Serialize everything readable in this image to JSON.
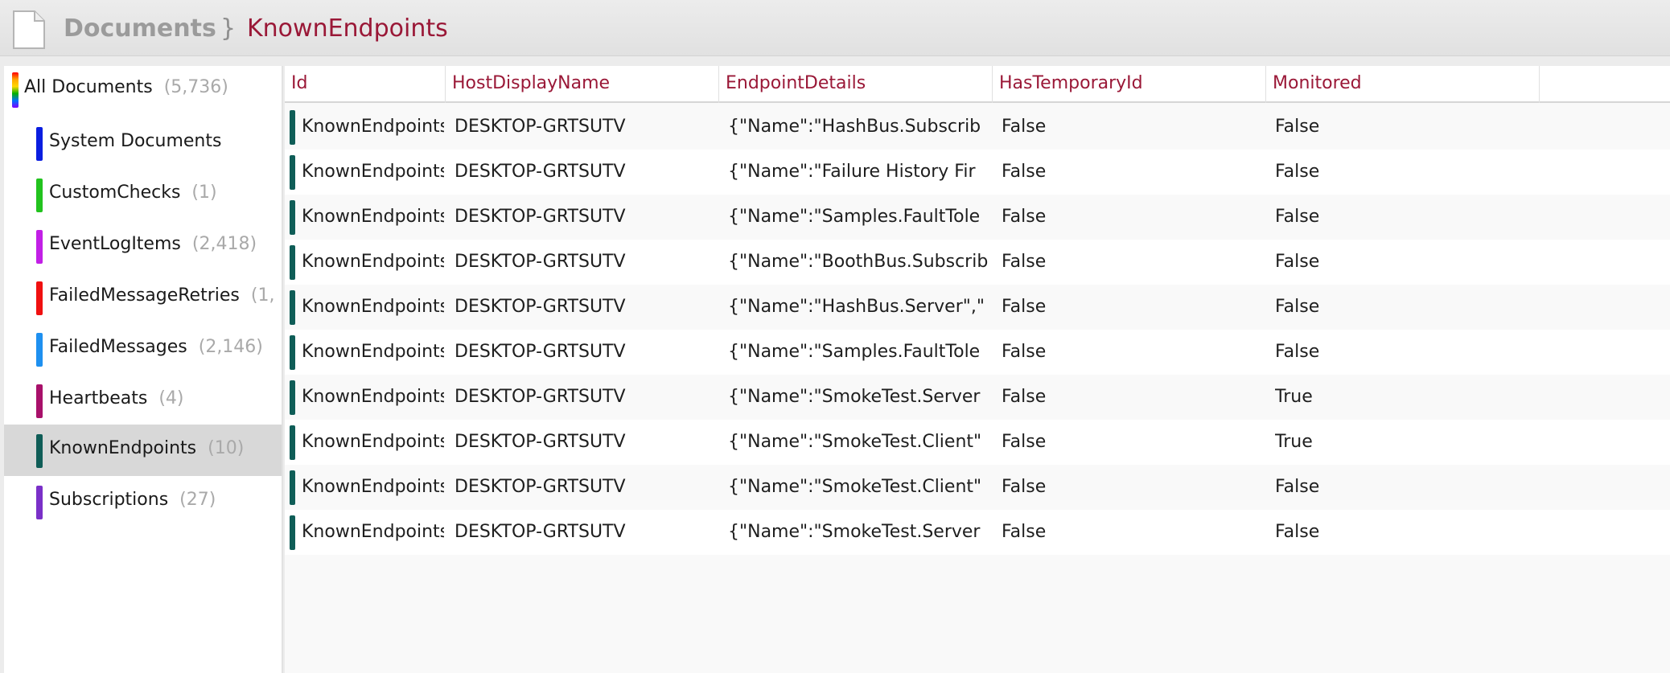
{
  "breadcrumb": {
    "root": "Documents",
    "separator": "}",
    "current": "KnownEndpoints"
  },
  "icons": {
    "document": "document-icon"
  },
  "colors": {
    "accent": "#9a1837",
    "row_marker": "#0f5d57",
    "selected_bg": "#d8d8d8"
  },
  "sidebar": {
    "items": [
      {
        "label": "All Documents",
        "count": "(5,736)",
        "color": "rainbow",
        "selected": false
      },
      {
        "label": "System Documents",
        "count": "",
        "color": "#0a1ee0",
        "selected": false
      },
      {
        "label": "CustomChecks",
        "count": "(1)",
        "color": "#22c31e",
        "selected": false
      },
      {
        "label": "EventLogItems",
        "count": "(2,418)",
        "color": "#c21fe6",
        "selected": false
      },
      {
        "label": "FailedMessageRetries",
        "count": "(1,",
        "color": "#f01010",
        "selected": false
      },
      {
        "label": "FailedMessages",
        "count": "(2,146)",
        "color": "#1e90f0",
        "selected": false
      },
      {
        "label": "Heartbeats",
        "count": "(4)",
        "color": "#a8106a",
        "selected": false
      },
      {
        "label": "KnownEndpoints",
        "count": "(10)",
        "color": "#0f5d57",
        "selected": true
      },
      {
        "label": "Subscriptions",
        "count": "(27)",
        "color": "#7a30c8",
        "selected": false
      }
    ]
  },
  "grid": {
    "columns": [
      "Id",
      "HostDisplayName",
      "EndpointDetails",
      "HasTemporaryId",
      "Monitored"
    ],
    "rows": [
      [
        "KnownEndpoints",
        "DESKTOP-GRTSUTV",
        "{\"Name\":\"HashBus.Subscrib",
        "False",
        "False"
      ],
      [
        "KnownEndpoints",
        "DESKTOP-GRTSUTV",
        "{\"Name\":\"Failure History Fir",
        "False",
        "False"
      ],
      [
        "KnownEndpoints",
        "DESKTOP-GRTSUTV",
        "{\"Name\":\"Samples.FaultTole",
        "False",
        "False"
      ],
      [
        "KnownEndpoints",
        "DESKTOP-GRTSUTV",
        "{\"Name\":\"BoothBus.Subscrib",
        "False",
        "False"
      ],
      [
        "KnownEndpoints",
        "DESKTOP-GRTSUTV",
        "{\"Name\":\"HashBus.Server\",\"",
        "False",
        "False"
      ],
      [
        "KnownEndpoints",
        "DESKTOP-GRTSUTV",
        "{\"Name\":\"Samples.FaultTole",
        "False",
        "False"
      ],
      [
        "KnownEndpoints",
        "DESKTOP-GRTSUTV",
        "{\"Name\":\"SmokeTest.Server",
        "False",
        "True"
      ],
      [
        "KnownEndpoints",
        "DESKTOP-GRTSUTV",
        "{\"Name\":\"SmokeTest.Client\"",
        "False",
        "True"
      ],
      [
        "KnownEndpoints",
        "DESKTOP-GRTSUTV",
        "{\"Name\":\"SmokeTest.Client\"",
        "False",
        "False"
      ],
      [
        "KnownEndpoints",
        "DESKTOP-GRTSUTV",
        "{\"Name\":\"SmokeTest.Server",
        "False",
        "False"
      ]
    ]
  }
}
